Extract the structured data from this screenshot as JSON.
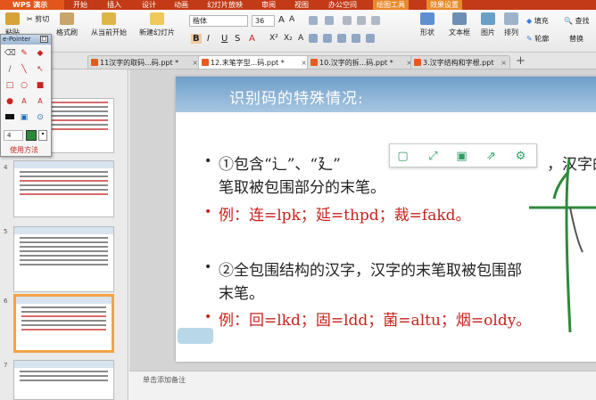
{
  "app": {
    "logo": "WPS 演示"
  },
  "menu": [
    {
      "label": "开始"
    },
    {
      "label": "插入"
    },
    {
      "label": "设计"
    },
    {
      "label": "动画"
    },
    {
      "label": "幻灯片放映"
    },
    {
      "label": "审阅"
    },
    {
      "label": "视图"
    },
    {
      "label": "办公空间"
    },
    {
      "label": "绘图工具"
    },
    {
      "label": "效果设置"
    }
  ],
  "ribbon": {
    "paste": "粘贴",
    "cut": "剪切",
    "format_painter": "格式刷",
    "from_current": "从当前开始",
    "new_slide": "新建幻灯片",
    "font": "楷体",
    "size": "36",
    "shape": "形状",
    "textbox": "文本框",
    "picture": "图片",
    "arrange": "排列",
    "fill": "填充",
    "outline": "轮廓",
    "find": "查找",
    "replace": "替换"
  },
  "tabs": [
    {
      "label": "11汉字的取码...码.ppt *"
    },
    {
      "label": "12.末笔字型...码.ppt *"
    },
    {
      "label": "10.汉字的拆...码.ppt *"
    },
    {
      "label": "3.汉字结构和字根.ppt"
    }
  ],
  "pointer": {
    "title": "e-Pointer",
    "usage": "使用方法",
    "width_value": "4"
  },
  "thumbs": [
    {
      "num": "4"
    },
    {
      "num": "5"
    },
    {
      "num": "6"
    },
    {
      "num": "7"
    }
  ],
  "slide": {
    "title": "识别码的特殊情况:",
    "line1": "①包含“辶”、“廴”",
    "line1_tail": "，汉字的",
    "line2": "笔取被包围部分的末笔。",
    "example1": "例：连=lpk；延=thpd；裁=fakd。",
    "line3": "②全包围结构的汉字，汉字的末笔取被包围部",
    "line4": "末笔。",
    "example2": "例：回=lkd；固=ldd；菌=altu；烟=oldy。"
  },
  "notes": {
    "placeholder": "单击添加备注"
  }
}
